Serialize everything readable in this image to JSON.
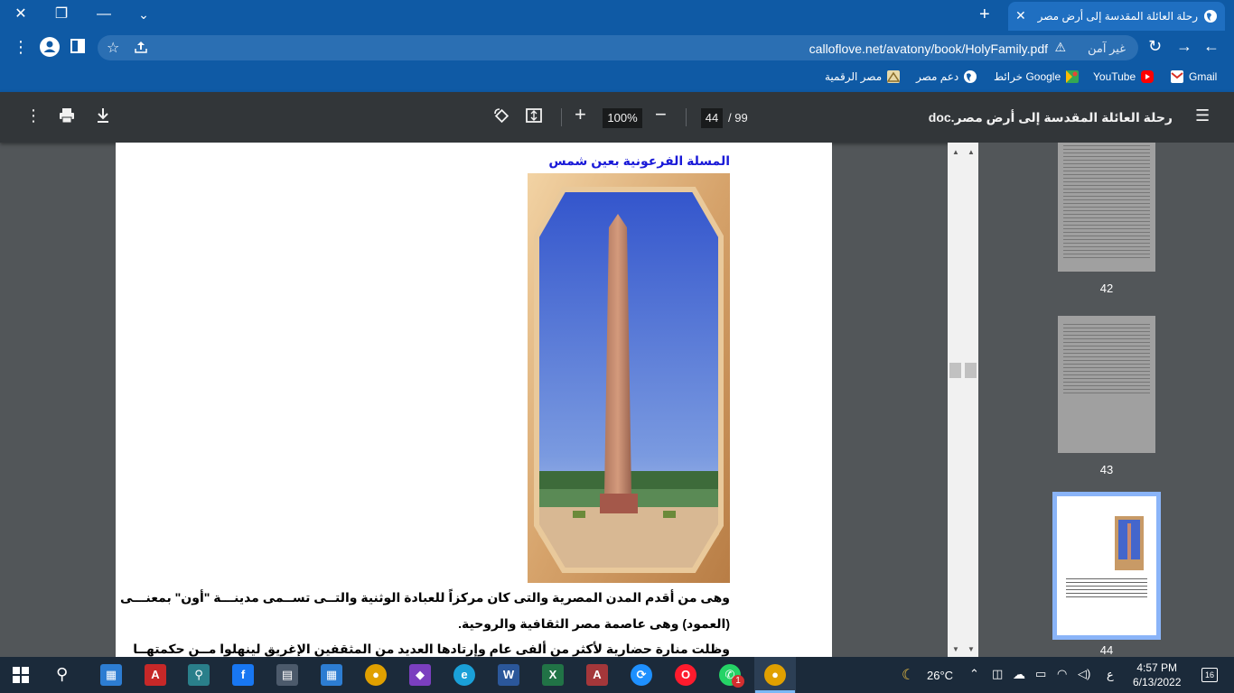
{
  "browser": {
    "tab_title": "رحلة العائلة المقدسة إلى أرض مصر",
    "security_label": "غير آمن",
    "url": "calloflove.net/avatony/book/HolyFamily.pdf"
  },
  "bookmarks": [
    {
      "label": "Gmail",
      "icon": "gmail-icon",
      "color": "#d93025"
    },
    {
      "label": "YouTube",
      "icon": "youtube-icon",
      "color": "#ff0000"
    },
    {
      "label": "خرائط Google",
      "icon": "maps-icon",
      "color": "#34a853"
    },
    {
      "label": "دعم مصر",
      "icon": "globe-icon",
      "color": "#ffffff"
    },
    {
      "label": "مصر الرقمية",
      "icon": "digital-egypt-icon",
      "color": "#e8d9a8"
    }
  ],
  "pdf_toolbar": {
    "title": "رحلة العائلة المقدسة إلى أرض مصر.doc",
    "current_page": "44",
    "total_pages": "/ 99",
    "zoom": "100%"
  },
  "document": {
    "heading": "المسلة الفرعونية بعين شمس",
    "heading_color": "#1a1ad8",
    "lines": [
      "وهى من أقدم المدن المصرية والتى كان مركزاً للعبادة الوثنية والتــى تســمى مدينـــة \"أون\" بمعنـــى",
      "(العمود) وهى عاصمة مصر الثقافية والروحية.",
      "وظلت منارة حضارية لأكثر من ألفى عام وإرتادها العديد من المثقفين الإغريق لينهلوا مــن حكمتهــا"
    ]
  },
  "thumbnails": [
    {
      "number": "42"
    },
    {
      "number": "43"
    },
    {
      "number": "44"
    }
  ],
  "taskbar": {
    "temperature": "26°C",
    "language": "ع",
    "time": "4:57 PM",
    "date": "6/13/2022",
    "notifications": "16",
    "whatsapp_badge": "1"
  }
}
